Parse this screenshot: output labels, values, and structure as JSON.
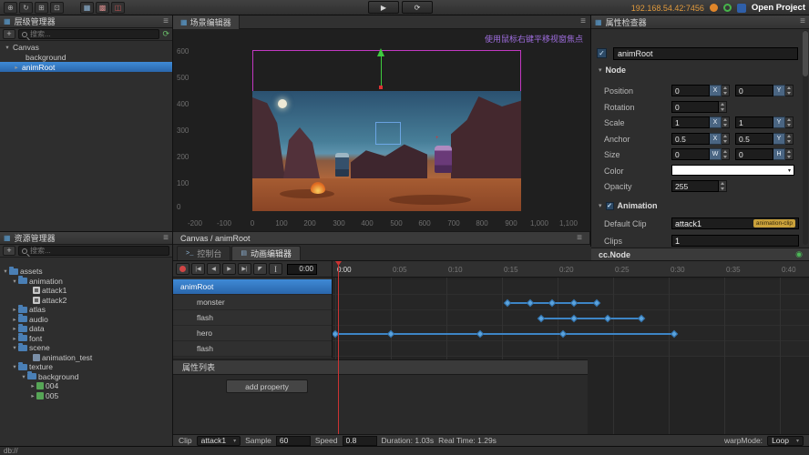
{
  "icons": {
    "play": "▶",
    "refresh": "⟳",
    "menu": "≡",
    "tool_1": "⊕",
    "tool_2": "↻",
    "tool_3": "⊞",
    "tool_4": "⊡",
    "tool_5": "▦",
    "tool_6": "▩",
    "tool_7": "◫",
    "panel": "▦",
    "console": ">_",
    "anim_tab": "▤",
    "prev_end": "|◀",
    "step_back": "◀",
    "play_small": "▶",
    "next_end": "▶|",
    "pointer": "◤",
    "ibeam": "I",
    "close": "×",
    "eye": "◉",
    "caret": "▾",
    "cross": "+"
  },
  "toolbar": {
    "ip": "192.168.54.42:7456",
    "open_project_label": "Open Project"
  },
  "hierarchy": {
    "title": "层级管理器",
    "add_button": "+",
    "search_placeholder": "搜索...",
    "items": [
      {
        "arrow": "▾",
        "label": "Canvas"
      },
      {
        "arrow": "",
        "label": "background"
      },
      {
        "arrow": "▸",
        "label": "animRoot"
      }
    ]
  },
  "assets": {
    "title": "资源管理器",
    "add_button": "+",
    "search_placeholder": "搜索...",
    "items": [
      {
        "arrow": "▾",
        "label": "assets"
      },
      {
        "arrow": "▾",
        "label": "animation"
      },
      {
        "arrow": "",
        "label": "attack1"
      },
      {
        "arrow": "",
        "label": "attack2"
      },
      {
        "arrow": "▸",
        "label": "atlas"
      },
      {
        "arrow": "▸",
        "label": "audio"
      },
      {
        "arrow": "▸",
        "label": "data"
      },
      {
        "arrow": "▸",
        "label": "font"
      },
      {
        "arrow": "▾",
        "label": "scene"
      },
      {
        "arrow": "",
        "label": "animation_test"
      },
      {
        "arrow": "▾",
        "label": "texture"
      },
      {
        "arrow": "▾",
        "label": "background"
      },
      {
        "arrow": "▸",
        "label": "004"
      },
      {
        "arrow": "▸",
        "label": "005"
      }
    ]
  },
  "scene": {
    "tab_title": "场景编辑器",
    "hint": "使用鼠标右键平移视窗焦点",
    "v_ruler": [
      "600",
      "500",
      "400",
      "300",
      "200",
      "100",
      "0"
    ],
    "h_ruler": [
      "-200",
      "-100",
      "0",
      "100",
      "200",
      "300",
      "400",
      "500",
      "600",
      "700",
      "800",
      "900",
      "1,000",
      "1,100"
    ]
  },
  "breadcrumb": {
    "path": "Canvas / animRoot"
  },
  "tabs": {
    "console": "控制台",
    "animation": "动画编辑器"
  },
  "animation": {
    "time_display": "0:00",
    "ruler": [
      "0:00",
      "0:05",
      "0:10",
      "0:15",
      "0:20",
      "0:25",
      "0:30",
      "0:35",
      "0:40"
    ],
    "tracks": [
      {
        "label": "animRoot",
        "selected": true,
        "keyframes": []
      },
      {
        "label": "monster",
        "selected": false,
        "keyframes": [
          15.5,
          17.5,
          19.5,
          21.5,
          23.5
        ]
      },
      {
        "label": "flash",
        "selected": false,
        "keyframes": [
          18.5,
          21.5,
          24.5,
          27.5
        ]
      },
      {
        "label": "hero",
        "selected": false,
        "keyframes": [
          0,
          5,
          13,
          20.5,
          30.5
        ]
      },
      {
        "label": "flash",
        "selected": false,
        "keyframes": []
      }
    ],
    "property_list_title": "属性列表",
    "add_property_label": "add property",
    "footer": {
      "clip_label": "Clip",
      "clip_value": "attack1",
      "sample_label": "Sample",
      "sample_value": "60",
      "speed_label": "Speed",
      "speed_value": "0.8",
      "duration": "Duration: 1.03s",
      "real_time": "Real Time: 1.29s",
      "warp_label": "warpMode:",
      "warp_value": "Loop"
    }
  },
  "inspector": {
    "title": "属性检查器",
    "node_name": "animRoot",
    "node_section": "Node",
    "rows": [
      {
        "label": "Position",
        "f1": "0",
        "a1": "X",
        "f2": "0",
        "a2": "Y"
      },
      {
        "label": "Rotation",
        "f1": "0"
      },
      {
        "label": "Scale",
        "f1": "1",
        "a1": "X",
        "f2": "1",
        "a2": "Y"
      },
      {
        "label": "Anchor",
        "f1": "0.5",
        "a1": "X",
        "f2": "0.5",
        "a2": "Y"
      },
      {
        "label": "Size",
        "f1": "0",
        "a1": "W",
        "f2": "0",
        "a2": "H"
      },
      {
        "label": "Color"
      },
      {
        "label": "Opacity",
        "f1": "255"
      }
    ],
    "anim_section": "Animation",
    "default_clip_label": "Default Clip",
    "default_clip_value": "attack1",
    "default_clip_badge": "animation-clip",
    "clips_label": "Clips",
    "clips_value": "1",
    "node_type": "cc.Node"
  },
  "status": "db://"
}
